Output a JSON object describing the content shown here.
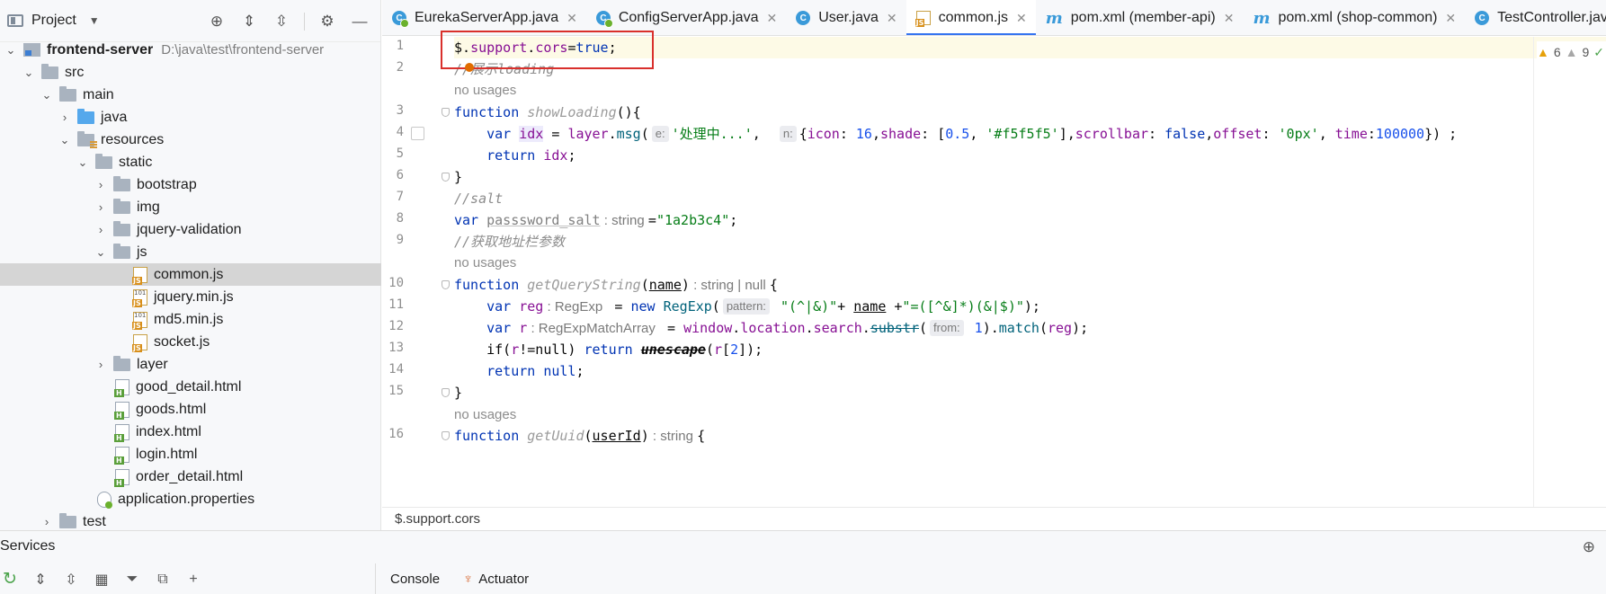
{
  "project": {
    "title": "Project",
    "tree": [
      {
        "label": "frontend-server",
        "path": "D:\\java\\test\\frontend-server",
        "type": "module",
        "chevron": "▾",
        "depth": 0,
        "bold": true
      },
      {
        "label": "src",
        "type": "folder",
        "chevron": "▾",
        "depth": 1
      },
      {
        "label": "main",
        "type": "folder",
        "chevron": "▾",
        "depth": 2
      },
      {
        "label": "java",
        "type": "folder-blue",
        "chevron": "›",
        "depth": 3
      },
      {
        "label": "resources",
        "type": "folder-res",
        "chevron": "▾",
        "depth": 3
      },
      {
        "label": "static",
        "type": "folder",
        "chevron": "▾",
        "depth": 4
      },
      {
        "label": "bootstrap",
        "type": "folder",
        "chevron": "›",
        "depth": 5
      },
      {
        "label": "img",
        "type": "folder",
        "chevron": "›",
        "depth": 5
      },
      {
        "label": "jquery-validation",
        "type": "folder",
        "chevron": "›",
        "depth": 5
      },
      {
        "label": "js",
        "type": "folder",
        "chevron": "▾",
        "depth": 5
      },
      {
        "label": "common.js",
        "type": "js",
        "chevron": "",
        "depth": 6,
        "selected": true
      },
      {
        "label": "jquery.min.js",
        "type": "js-min",
        "chevron": "",
        "depth": 6
      },
      {
        "label": "md5.min.js",
        "type": "js-min",
        "chevron": "",
        "depth": 6
      },
      {
        "label": "socket.js",
        "type": "js",
        "chevron": "",
        "depth": 6
      },
      {
        "label": "layer",
        "type": "folder",
        "chevron": "›",
        "depth": 5
      },
      {
        "label": "good_detail.html",
        "type": "html",
        "chevron": "",
        "depth": 5
      },
      {
        "label": "goods.html",
        "type": "html",
        "chevron": "",
        "depth": 5
      },
      {
        "label": "index.html",
        "type": "html",
        "chevron": "",
        "depth": 5
      },
      {
        "label": "login.html",
        "type": "html",
        "chevron": "",
        "depth": 5
      },
      {
        "label": "order_detail.html",
        "type": "html",
        "chevron": "",
        "depth": 5
      },
      {
        "label": "application.properties",
        "type": "props",
        "chevron": "",
        "depth": 4
      },
      {
        "label": "test",
        "type": "folder",
        "chevron": "›",
        "depth": 2
      }
    ]
  },
  "tabs": [
    {
      "label": "EurekaServerApp.java",
      "icon": "spring-class-icon",
      "active": false
    },
    {
      "label": "ConfigServerApp.java",
      "icon": "spring-class-icon",
      "active": false
    },
    {
      "label": "User.java",
      "icon": "class-icon",
      "active": false
    },
    {
      "label": "common.js",
      "icon": "js-file-icon",
      "active": true
    },
    {
      "label": "pom.xml (member-api)",
      "icon": "maven-icon",
      "active": false
    },
    {
      "label": "pom.xml (shop-common)",
      "icon": "maven-icon",
      "active": false
    },
    {
      "label": "TestController.java",
      "icon": "class-icon",
      "active": false
    }
  ],
  "editor": {
    "line_numbers": [
      "1",
      "2",
      "3",
      "4",
      "5",
      "6",
      "7",
      "8",
      "9",
      "10",
      "11",
      "12",
      "13",
      "14",
      "15",
      "16"
    ],
    "no_usages": "no usages",
    "code": {
      "l1": {
        "a": "$.",
        "b": "support",
        "c": ".",
        "d": "cors",
        "e": "=",
        "f": "true",
        "g": ";"
      },
      "l2": {
        "a": "//展示loading"
      },
      "l3": {
        "a": "function ",
        "b": "showLoading",
        "c": "(){"
      },
      "l4": {
        "a": "    var ",
        "b": "idx",
        "c": " = ",
        "d": "layer",
        "e": ".",
        "f": "msg",
        "g": "(",
        "h1": "e:",
        "h2": "'处理中...'",
        "h3": ",  ",
        "h4": "n:",
        "h5": "{",
        "h6": "icon",
        "h7": ": ",
        "h8": "16",
        "h9": ",",
        "h10": "shade",
        "h11": ": [",
        "h12": "0.5",
        "h13": ", ",
        "h14": "'#f5f5f5'",
        "h15": "],",
        "h16": "scrollbar",
        "h17": ": ",
        "h18": "false",
        "h19": ",",
        "h20": "offset",
        "h21": ": ",
        "h22": "'0px'",
        "h23": ", ",
        "h24": "time",
        "h25": ":",
        "h26": "100000",
        "h27": "}) ;"
      },
      "l5": {
        "a": "    return ",
        "b": "idx",
        "c": ";"
      },
      "l6": {
        "a": "}"
      },
      "l7": {
        "a": "//salt"
      },
      "l8": {
        "a": "var ",
        "b": "passsword_salt",
        "c": " : string ",
        "d": "=",
        "e": "\"1a2b3c4\"",
        "f": ";"
      },
      "l9": {
        "a": "//获取地址栏参数"
      },
      "l10": {
        "a": "function ",
        "b": "getQueryString",
        "c": "(",
        "d": "name",
        "e": ")",
        "f": " : string | null ",
        "g": "{"
      },
      "l11": {
        "a": "    var ",
        "b": "reg",
        "c": " : RegExp ",
        "d": " = ",
        "e": "new ",
        "f": "RegExp",
        "g": "(",
        "h": "pattern:",
        "i": " \"(^|&)\"",
        "j": "+ ",
        "k": "name",
        "l": " +",
        "m": "\"=([^&]*)(&|$)\"",
        "n": ");"
      },
      "l12": {
        "a": "    var ",
        "b": "r",
        "c": " : RegExpMatchArray ",
        "d": " = ",
        "e": "window",
        "f": ".",
        "g": "location",
        "h": ".",
        "i": "search",
        "j": ".",
        "k": "substr",
        "l": "(",
        "m": "from:",
        "n": " 1",
        "o": ").",
        "p": "match",
        "q": "(",
        "r": "reg",
        "s": ");"
      },
      "l13": {
        "a": "    if(",
        "b": "r",
        "c": "!=null) ",
        "d": "return ",
        "e": "unescape",
        "f": "(",
        "g": "r",
        "h": "[",
        "i": "2",
        "j": "]);"
      },
      "l14": {
        "a": "    return ",
        "b": "null",
        "c": ";"
      },
      "l15": {
        "a": "}"
      },
      "l16": {
        "a": "function ",
        "b": "getUuid",
        "c": "(",
        "d": "userId",
        "e": ")",
        "f": " : string ",
        "g": "{"
      }
    },
    "inspections": {
      "warnings": "6",
      "weak_warnings": "9"
    }
  },
  "breadcrumb": "$.support.cors",
  "services": {
    "title": "Services",
    "tabs": [
      {
        "label": "Console"
      },
      {
        "label": "Actuator"
      }
    ]
  },
  "colors": {
    "accent": "#3574f0",
    "highlight_box": "#d9302c",
    "keyword": "#0033b3",
    "string": "#067d17",
    "number": "#1750eb"
  }
}
